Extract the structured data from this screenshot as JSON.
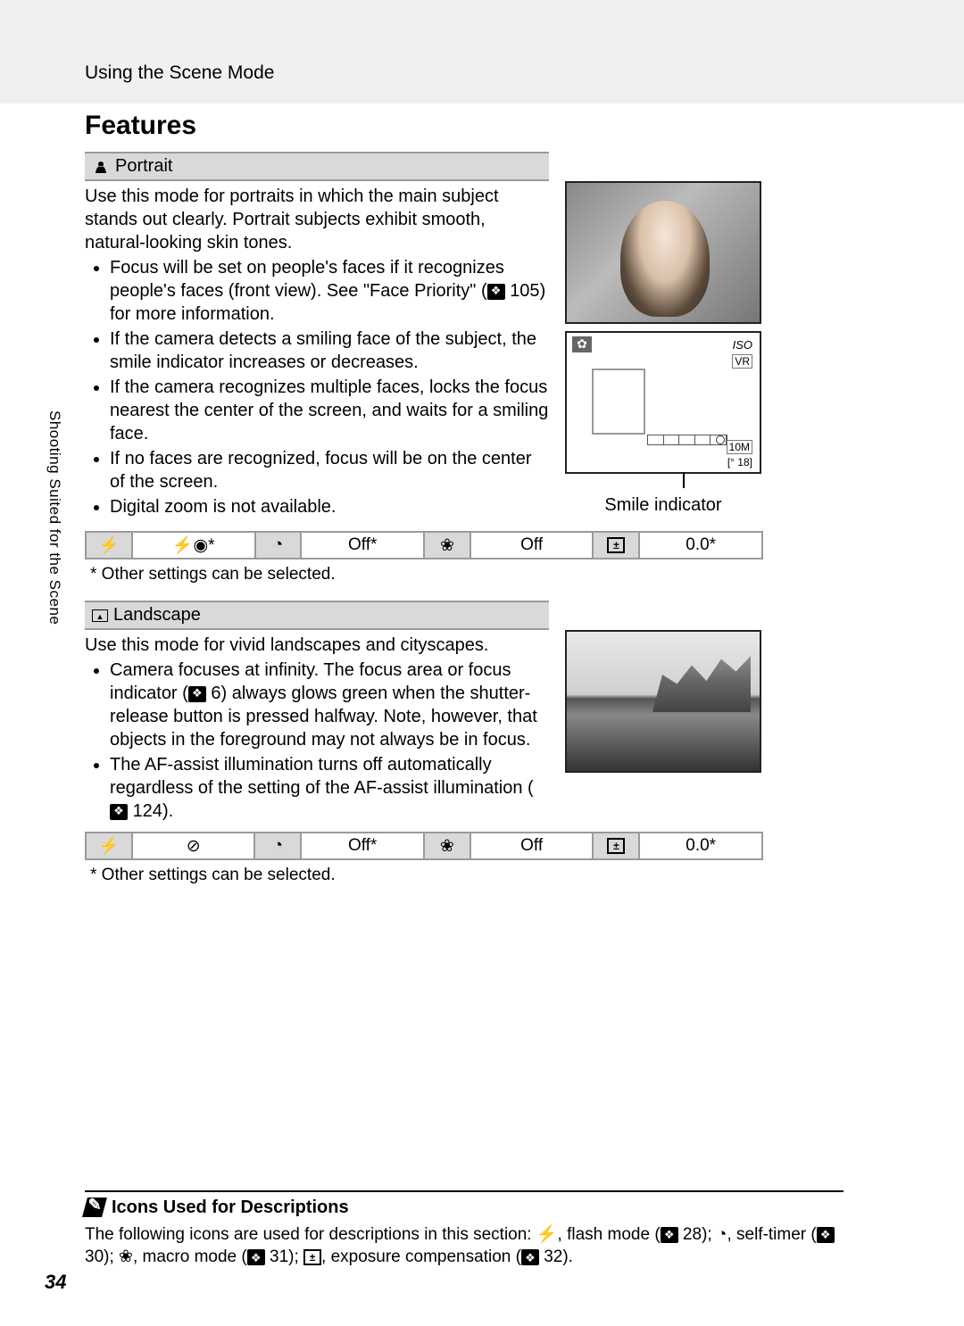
{
  "header": {
    "section": "Using the Scene Mode"
  },
  "title": "Features",
  "side_tab": "Shooting Suited for the Scene",
  "portrait": {
    "name": "Portrait",
    "intro": "Use this mode for portraits in which the main subject stands out clearly. Portrait subjects exhibit smooth, natural-looking skin tones.",
    "bullets": [
      "Focus will be set on people's faces if it recognizes people's faces (front view). See \"Face Priority\" (🔖 105) for more information.",
      "If the camera detects a smiling face of the subject, the smile indicator increases or decreases.",
      "If the camera recognizes multiple faces, locks the focus nearest the center of the screen, and waits for a smiling face.",
      "If no faces are recognized, focus will be on the center of the screen.",
      "Digital zoom is not available."
    ],
    "smile_label": "Smile indicator",
    "lcd": {
      "vr": "VR",
      "iso": "ISO",
      "mode_badge": "10M",
      "remaining": "[° 18]"
    },
    "settings": {
      "flash_value": "⚡◉*",
      "timer_value": "Off*",
      "macro_value": "Off",
      "exposure_value": "0.0*"
    },
    "footnote": "*  Other settings can be selected."
  },
  "landscape": {
    "name": "Landscape",
    "intro": "Use this mode for vivid landscapes and cityscapes.",
    "bullets": [
      "Camera focuses at infinity. The focus area or focus indicator (🔖 6) always glows green when the shutter-release button is pressed halfway. Note, however, that objects in the foreground may not always be in focus.",
      "The AF-assist illumination turns off automatically regardless of the setting of the AF-assist illumination (🔖 124)."
    ],
    "settings": {
      "flash_value": "⊘",
      "timer_value": "Off*",
      "macro_value": "Off",
      "exposure_value": "0.0*"
    },
    "footnote": "*  Other settings can be selected."
  },
  "icons_note": {
    "title": "Icons Used for Descriptions",
    "body_pre": "The following icons are used for descriptions in this section: ",
    "flash_label": ", flash mode (",
    "flash_ref": " 28); ",
    "timer_label": ", self-timer (",
    "timer_ref": " 30); ",
    "macro_label": ", macro mode (",
    "macro_ref": " 31); ",
    "exp_label": ", exposure compensation (",
    "exp_ref": " 32)."
  },
  "page_number": "34",
  "refs": {
    "face_priority": "105",
    "focus_indicator": "6",
    "af_assist": "124",
    "flash": "28",
    "timer": "30",
    "macro": "31",
    "exp": "32"
  }
}
